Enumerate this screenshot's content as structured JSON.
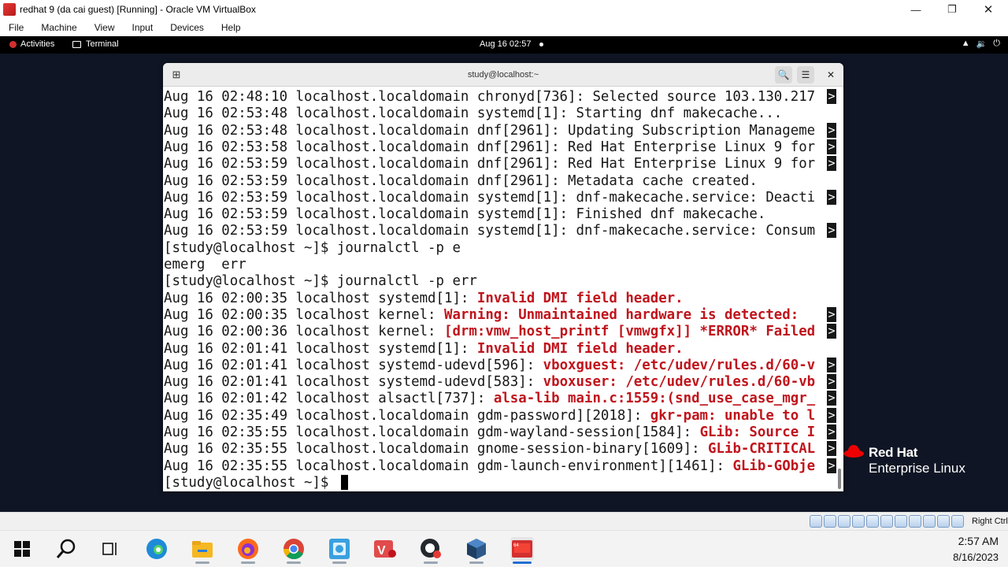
{
  "vbox": {
    "title": "redhat 9 (da cai guest) [Running] - Oracle VM VirtualBox",
    "menu": [
      "File",
      "Machine",
      "View",
      "Input",
      "Devices",
      "Help"
    ],
    "host_key": "Right Ctrl"
  },
  "gnome": {
    "activities": "Activities",
    "app": "Terminal",
    "clock": "Aug 16  02:57"
  },
  "branding": {
    "name": "Red Hat",
    "product": "Enterprise Linux"
  },
  "terminal": {
    "title": "study@localhost:~",
    "lines": [
      {
        "t": "Aug 16 02:48:10 localhost.localdomain chronyd[736]: Selected source 103.130.217",
        "trunc": true
      },
      {
        "t": "Aug 16 02:53:48 localhost.localdomain systemd[1]: Starting dnf makecache...",
        "trunc": false
      },
      {
        "t": "Aug 16 02:53:48 localhost.localdomain dnf[2961]: Updating Subscription Manageme",
        "trunc": true
      },
      {
        "t": "Aug 16 02:53:58 localhost.localdomain dnf[2961]: Red Hat Enterprise Linux 9 for",
        "trunc": true
      },
      {
        "t": "Aug 16 02:53:59 localhost.localdomain dnf[2961]: Red Hat Enterprise Linux 9 for",
        "trunc": true
      },
      {
        "t": "Aug 16 02:53:59 localhost.localdomain dnf[2961]: Metadata cache created.",
        "trunc": false
      },
      {
        "t": "Aug 16 02:53:59 localhost.localdomain systemd[1]: dnf-makecache.service: Deacti",
        "trunc": true
      },
      {
        "t": "Aug 16 02:53:59 localhost.localdomain systemd[1]: Finished dnf makecache.",
        "trunc": false
      },
      {
        "t": "Aug 16 02:53:59 localhost.localdomain systemd[1]: dnf-makecache.service: Consum",
        "trunc": true
      },
      {
        "t": "[study@localhost ~]$ journalctl -p e",
        "trunc": false
      },
      {
        "t": "emerg  err",
        "trunc": false
      },
      {
        "t": "[study@localhost ~]$ journalctl -p err",
        "trunc": false
      },
      {
        "p": "Aug 16 02:00:35 localhost systemd[1]: ",
        "e": "Invalid DMI field header.",
        "trunc": false
      },
      {
        "p": "Aug 16 02:00:35 localhost kernel: ",
        "e": "Warning: Unmaintained hardware is detected:",
        "trunc": true
      },
      {
        "p": "Aug 16 02:00:36 localhost kernel: ",
        "e": "[drm:vmw_host_printf [vmwgfx]] *ERROR* Failed",
        "trunc": true
      },
      {
        "p": "Aug 16 02:01:41 localhost systemd[1]: ",
        "e": "Invalid DMI field header.",
        "trunc": false
      },
      {
        "p": "Aug 16 02:01:41 localhost systemd-udevd[596]: ",
        "e": "vboxguest: /etc/udev/rules.d/60-v",
        "trunc": true
      },
      {
        "p": "Aug 16 02:01:41 localhost systemd-udevd[583]: ",
        "e": "vboxuser: /etc/udev/rules.d/60-vb",
        "trunc": true
      },
      {
        "p": "Aug 16 02:01:42 localhost alsactl[737]: ",
        "e": "alsa-lib main.c:1559:(snd_use_case_mgr_",
        "trunc": true
      },
      {
        "p": "Aug 16 02:35:49 localhost.localdomain gdm-password][2018]: ",
        "e": "gkr-pam: unable to l",
        "trunc": true
      },
      {
        "p": "Aug 16 02:35:55 localhost.localdomain gdm-wayland-session[1584]: ",
        "e": "GLib: Source I",
        "trunc": true
      },
      {
        "p": "Aug 16 02:35:55 localhost.localdomain gnome-session-binary[1609]: ",
        "e": "GLib-CRITICAL",
        "trunc": true
      },
      {
        "p": "Aug 16 02:35:55 localhost.localdomain gdm-launch-environment][1461]: ",
        "e": "GLib-GObje",
        "trunc": true
      },
      {
        "t": "[study@localhost ~]$ ",
        "trunc": false
      }
    ]
  },
  "taskbar": {
    "time": "2:57 AM",
    "date": "8/16/2023",
    "apps": [
      "start-icon",
      "search-icon",
      "task-view-icon",
      "edge-icon",
      "file-explorer-icon",
      "firefox-icon",
      "chrome-icon",
      "photos-icon",
      "vmware-icon",
      "github-desktop-icon",
      "virtualbox-icon",
      "redhat-vm-icon"
    ]
  },
  "colors": {
    "error_text": "#c0141c",
    "terminal_bg": "#ffffff",
    "guest_bg": "#0f1524",
    "redhat_red": "#ee0000"
  }
}
